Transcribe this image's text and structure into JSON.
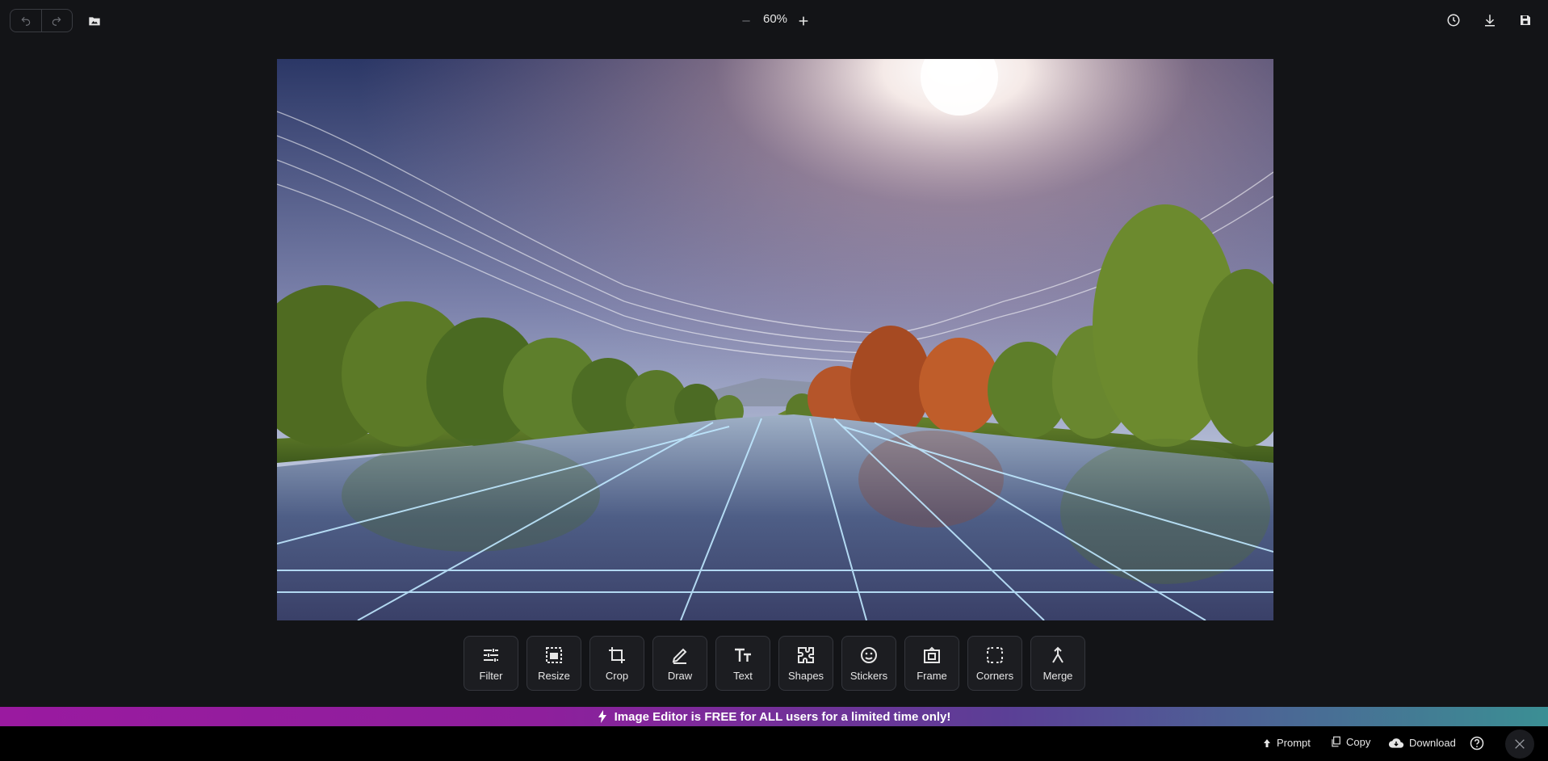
{
  "toolbar": {
    "undo_icon": "undo-icon",
    "redo_icon": "redo-icon",
    "open_icon": "folder-image-icon",
    "zoom": "60%",
    "history_icon": "history-icon",
    "download_icon": "download-icon",
    "save_icon": "save-icon"
  },
  "tools": [
    {
      "label": "Filter",
      "icon": "sliders-icon"
    },
    {
      "label": "Resize",
      "icon": "resize-icon"
    },
    {
      "label": "Crop",
      "icon": "crop-icon"
    },
    {
      "label": "Draw",
      "icon": "pencil-icon"
    },
    {
      "label": "Text",
      "icon": "text-icon"
    },
    {
      "label": "Shapes",
      "icon": "shapes-icon"
    },
    {
      "label": "Stickers",
      "icon": "sticker-icon"
    },
    {
      "label": "Frame",
      "icon": "frame-icon"
    },
    {
      "label": "Corners",
      "icon": "corners-icon"
    },
    {
      "label": "Merge",
      "icon": "merge-icon"
    }
  ],
  "banner": {
    "text": "Image Editor is FREE for ALL users for a limited time only!"
  },
  "bottom": {
    "prompt_label": "Prompt",
    "copy_label": "Copy",
    "download_label": "Download"
  },
  "colors": {
    "background": "#131417",
    "banner_start": "#9a1aa0",
    "banner_end": "#3b8f94"
  }
}
